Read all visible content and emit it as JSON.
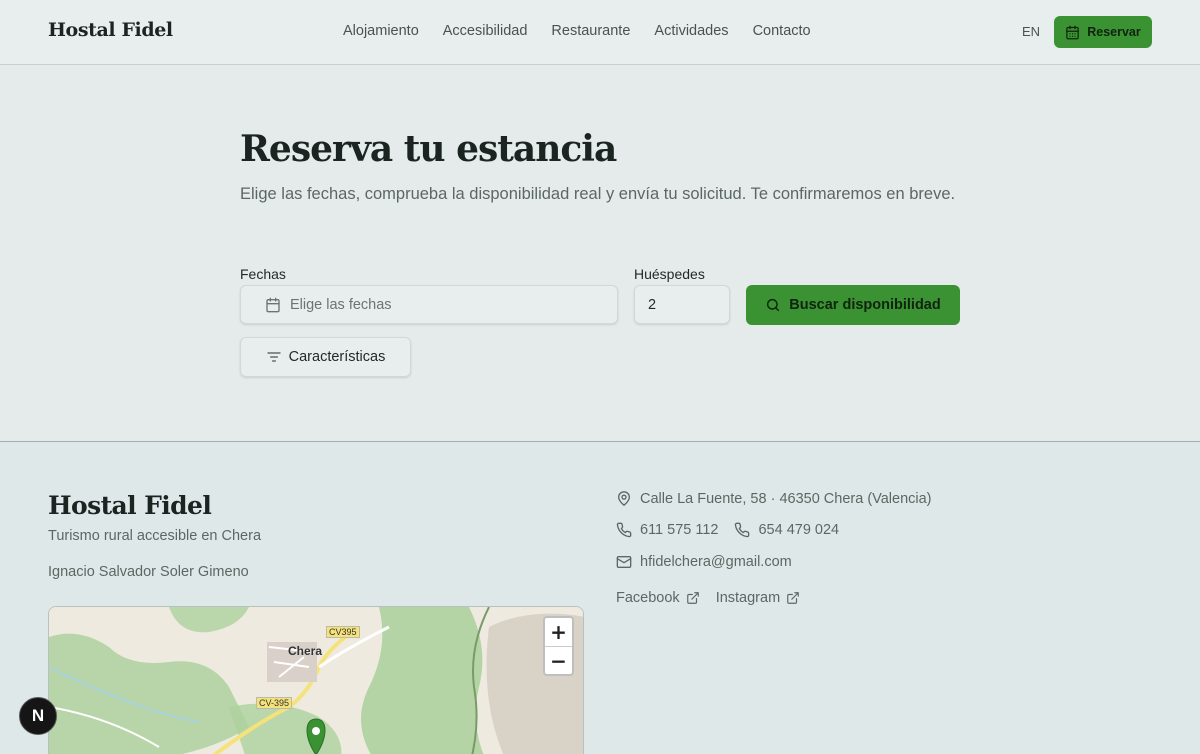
{
  "header": {
    "brand": "Hostal Fidel",
    "nav": [
      "Alojamiento",
      "Accesibilidad",
      "Restaurante",
      "Actividades",
      "Contacto"
    ],
    "lang": "EN",
    "reserve_label": "Reservar"
  },
  "main": {
    "title": "Reserva tu estancia",
    "subtitle": "Elige las fechas, comprueba la disponibilidad real y envía tu solicitud. Te confirmaremos en breve.",
    "dates_label": "Fechas",
    "dates_placeholder": "Elige las fechas",
    "guests_label": "Huéspedes",
    "guests_value": "2",
    "search_label": "Buscar disponibilidad",
    "features_label": "Características"
  },
  "footer": {
    "brand": "Hostal Fidel",
    "tagline": "Turismo rural accesible en Chera",
    "owner": "Ignacio Salvador Soler Gimeno",
    "address": "Calle La Fuente, 58 · 46350 Chera (Valencia)",
    "phone1": "611 575 112",
    "phone2": "654 479 024",
    "email": "hfidelchera@gmail.com",
    "facebook": "Facebook",
    "instagram": "Instagram"
  },
  "map": {
    "town_label": "Chera",
    "road1": "CV395",
    "road2": "CV-395",
    "zoom_in": "+",
    "zoom_out": "−"
  },
  "dev_badge": "N",
  "colors": {
    "accent": "#3a9233",
    "background": "#e5ebea",
    "text_muted": "#5c6763"
  },
  "icons": [
    "calendar-icon",
    "search-icon",
    "filter-icon",
    "map-pin-icon",
    "phone-icon",
    "mail-icon",
    "external-link-icon"
  ]
}
